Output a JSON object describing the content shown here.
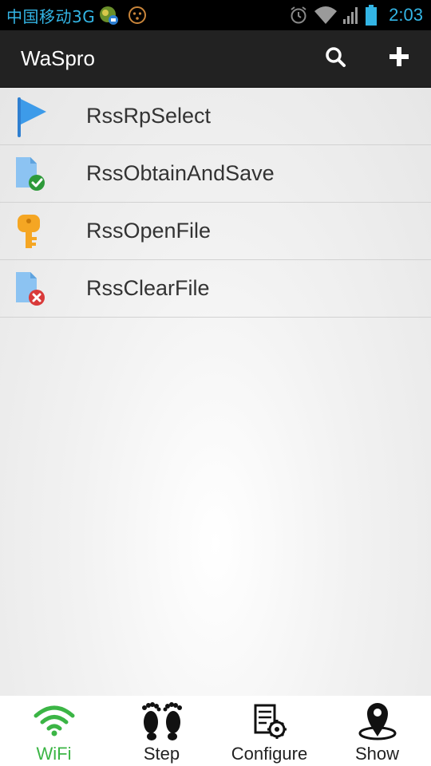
{
  "status_bar": {
    "carrier": "中国移动3G",
    "time": "2:03",
    "icons": [
      "app-notification-icon",
      "emoji-notification-icon",
      "alarm-icon",
      "wifi-signal-icon",
      "cell-signal-icon",
      "battery-icon"
    ]
  },
  "action_bar": {
    "title": "WaSpro",
    "actions": [
      "search-icon",
      "add-icon"
    ]
  },
  "list": {
    "items": [
      {
        "label": "RssRpSelect",
        "icon": "flag-icon"
      },
      {
        "label": "RssObtainAndSave",
        "icon": "file-check-icon"
      },
      {
        "label": "RssOpenFile",
        "icon": "key-icon"
      },
      {
        "label": "RssClearFile",
        "icon": "file-delete-icon"
      }
    ]
  },
  "bottom_nav": {
    "items": [
      {
        "label": "WiFi",
        "icon": "wifi-icon",
        "active": true
      },
      {
        "label": "Step",
        "icon": "footprints-icon",
        "active": false
      },
      {
        "label": "Configure",
        "icon": "configure-icon",
        "active": false
      },
      {
        "label": "Show",
        "icon": "map-pin-icon",
        "active": false
      }
    ]
  },
  "colors": {
    "status_text": "#33b5e5",
    "action_bar": "#222222",
    "active_tab": "#3bb545",
    "flag": "#3d9be9",
    "key": "#f5a623"
  }
}
